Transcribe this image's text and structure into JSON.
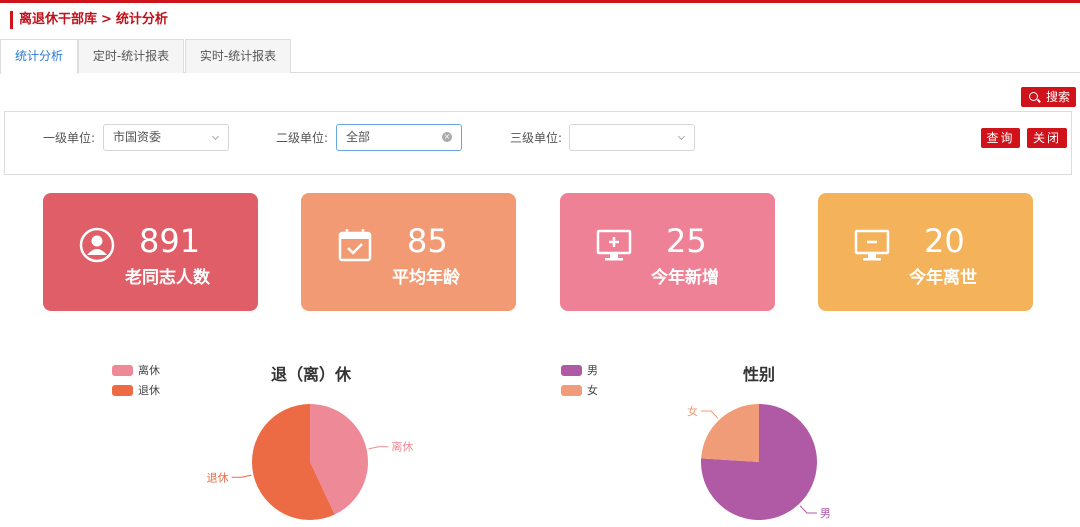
{
  "breadcrumb": {
    "parent": "离退休干部库",
    "separator": ">",
    "current": "统计分析"
  },
  "tabs": [
    {
      "label": "统计分析",
      "active": true
    },
    {
      "label": "定时-统计报表",
      "active": false
    },
    {
      "label": "实时-统计报表",
      "active": false
    }
  ],
  "search_button": {
    "label": "搜索",
    "icon": "search-icon"
  },
  "filters": {
    "level1": {
      "label": "一级单位:",
      "value": "市国资委"
    },
    "level2": {
      "label": "二级单位:",
      "value": "全部"
    },
    "level3": {
      "label": "三级单位:",
      "value": ""
    },
    "query_label": "查询",
    "close_label": "关闭"
  },
  "stats": [
    {
      "value": "891",
      "label": "老同志人数",
      "icon": "user-avatar-icon",
      "color": "#e05e67"
    },
    {
      "value": "85",
      "label": "平均年龄",
      "icon": "calendar-icon",
      "color": "#f19a74"
    },
    {
      "value": "25",
      "label": "今年新增",
      "icon": "monitor-plus-icon",
      "color": "#ee8195"
    },
    {
      "value": "20",
      "label": "今年离世",
      "icon": "monitor-minus-icon",
      "color": "#f4b35a"
    }
  ],
  "chart_data": [
    {
      "type": "pie",
      "title": "退（离）休",
      "legend_position": "top-left",
      "categories": [
        "离休",
        "退休"
      ],
      "values": [
        43,
        57
      ],
      "colors": [
        "#ee8a97",
        "#ec6a44"
      ]
    },
    {
      "type": "pie",
      "title": "性别",
      "legend_position": "top-left",
      "categories": [
        "男",
        "女"
      ],
      "values": [
        76,
        24
      ],
      "colors": [
        "#b05aa5",
        "#f19c78"
      ]
    }
  ]
}
